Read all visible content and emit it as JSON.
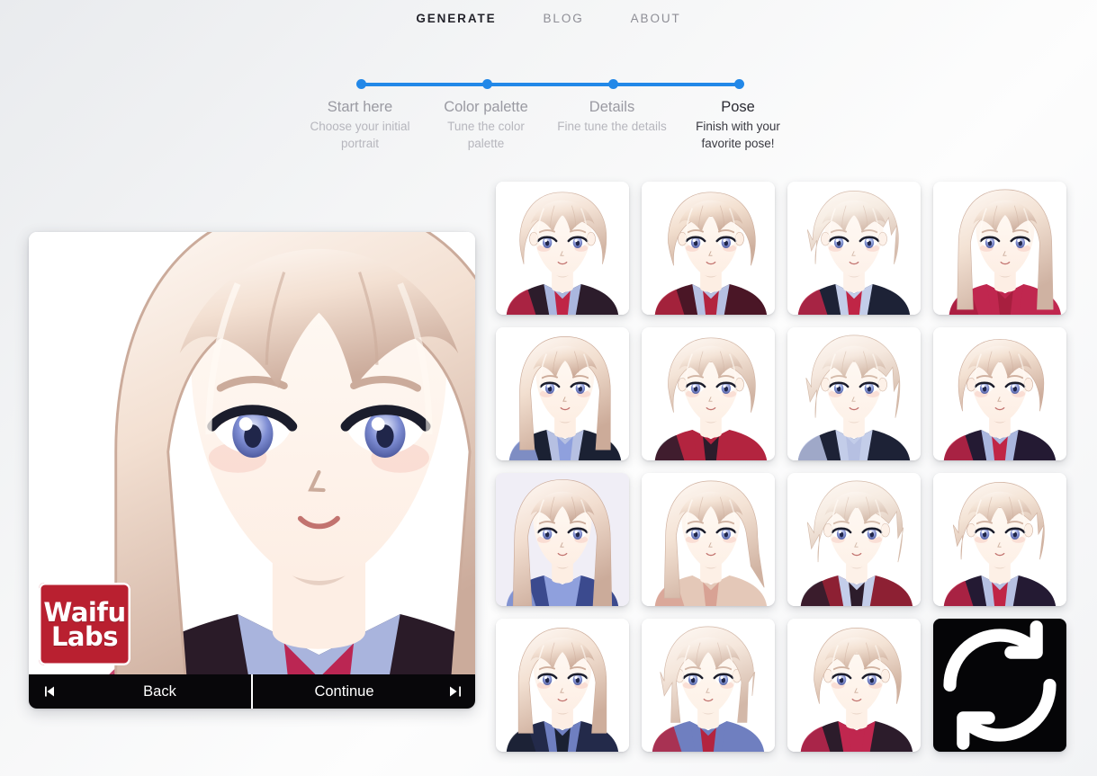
{
  "nav": {
    "items": [
      {
        "label": "GENERATE",
        "active": true
      },
      {
        "label": "BLOG",
        "active": false
      },
      {
        "label": "ABOUT",
        "active": false
      }
    ]
  },
  "stepper": {
    "accent_color": "#2288e8",
    "steps": [
      {
        "title": "Start here",
        "desc": "Choose your initial portrait",
        "active": false
      },
      {
        "title": "Color palette",
        "desc": "Tune the color palette",
        "active": false
      },
      {
        "title": "Details",
        "desc": "Fine tune the details",
        "active": false
      },
      {
        "title": "Pose",
        "desc": "Finish with your favorite pose!",
        "active": true
      }
    ]
  },
  "portrait": {
    "logo": {
      "line1": "Waifu",
      "line2": "Labs",
      "color": "#b92030"
    },
    "controls": {
      "back_label": "Back",
      "continue_label": "Continue",
      "back_icon": "skip-previous-icon",
      "continue_icon": "skip-next-icon"
    },
    "selected": {
      "hair_color": "#f3e0d2",
      "hair_shadow": "#cbab9b",
      "skin": "#fdeee4",
      "eye_color": "#7f8ed4",
      "collar": "#a9b4dd",
      "jacket": "#2a1b28",
      "accent": "#bb2653",
      "pose": "front-bust",
      "hair_style": "bob-long-bangs"
    }
  },
  "grid": {
    "columns": 4,
    "rows": 4,
    "reroll": {
      "icon": "refresh-icon",
      "label": ""
    },
    "tiles": [
      {
        "id": 1,
        "hair": "#f4e3d6",
        "shadow": "#d2b5a4",
        "skin": "#fdf0e7",
        "eye": "#8b98d8",
        "jacket": "#2c1c2b",
        "accent": "#c02546",
        "collar": "#aab6de",
        "pose": "front",
        "hair_style": "short-side-part",
        "bg": "#ffffff"
      },
      {
        "id": 2,
        "hair": "#f3e0d0",
        "shadow": "#cdae9c",
        "skin": "#fdeee3",
        "eye": "#8b98d8",
        "jacket": "#4a1626",
        "accent": "#b3243f",
        "collar": "#b6c0e2",
        "pose": "three-quarter",
        "hair_style": "swept-back",
        "bg": "#ffffff"
      },
      {
        "id": 3,
        "hair": "#f6ece2",
        "shadow": "#d6bdae",
        "skin": "#fdf1e9",
        "eye": "#8fa0dd",
        "jacket": "#1d2236",
        "accent": "#c02546",
        "collar": "#c3cde9",
        "pose": "front",
        "hair_style": "spiky",
        "bg": "#ffffff"
      },
      {
        "id": 4,
        "hair": "#f3e2d4",
        "shadow": "#cfb2a2",
        "skin": "#fdeee4",
        "eye": "#8b98d8",
        "jacket": "#c0274f",
        "accent": "#a81f3f",
        "collar": "#c0274f",
        "pose": "side-look",
        "hair_style": "long-straight",
        "bg": "#ffffff"
      },
      {
        "id": 5,
        "hair": "#f2dfd0",
        "shadow": "#ccab99",
        "skin": "#fdeee3",
        "eye": "#8b98d8",
        "jacket": "#1b2133",
        "accent": "#8fa0dd",
        "collar": "#b6c0e2",
        "pose": "three-quarter",
        "hair_style": "long-bangs",
        "bg": "#ffffff"
      },
      {
        "id": 6,
        "hair": "#f4e4d7",
        "shadow": "#d1b4a3",
        "skin": "#fdf0e6",
        "eye": "#8b98d8",
        "jacket": "#b3243f",
        "accent": "#2c1c2b",
        "collar": "#b3243f",
        "pose": "three-quarter",
        "hair_style": "short-fluffy",
        "bg": "#ffffff"
      },
      {
        "id": 7,
        "hair": "#f5e8de",
        "shadow": "#d4baa9",
        "skin": "#fdf1e8",
        "eye": "#8fa0dd",
        "jacket": "#1d2236",
        "accent": "#b6c0e2",
        "collar": "#c3cde9",
        "pose": "front",
        "hair_style": "messy-medium",
        "bg": "#ffffff"
      },
      {
        "id": 8,
        "hair": "#f3e1d2",
        "shadow": "#ceae9d",
        "skin": "#fdeee4",
        "eye": "#8b98d8",
        "jacket": "#241a33",
        "accent": "#c02546",
        "collar": "#aab6de",
        "pose": "front",
        "hair_style": "short-tidy",
        "bg": "#ffffff"
      },
      {
        "id": 9,
        "hair": "#f2ded0",
        "shadow": "#cbab9a",
        "skin": "#fdeee3",
        "eye": "#8b98d8",
        "jacket": "#3b4a8e",
        "accent": "#8fa0dd",
        "collar": "#8fa0dd",
        "pose": "front",
        "hair_style": "very-long",
        "bg": "#f0eef6"
      },
      {
        "id": 10,
        "hair": "#f4e3d5",
        "shadow": "#d0b2a1",
        "skin": "#fdf0e6",
        "eye": "#8fa0dd",
        "jacket": "#e4c8b8",
        "accent": "#d8a294",
        "collar": "#e4c8b8",
        "pose": "three-quarter",
        "hair_style": "long-ponytail",
        "bg": "#ffffff"
      },
      {
        "id": 11,
        "hair": "#f6ebe1",
        "shadow": "#d5bcac",
        "skin": "#fdf1e8",
        "eye": "#8b98d8",
        "jacket": "#8d2033",
        "accent": "#2c1c2b",
        "collar": "#c3cde9",
        "pose": "three-quarter",
        "hair_style": "spiky-fluffy",
        "bg": "#ffffff"
      },
      {
        "id": 12,
        "hair": "#f4e4d6",
        "shadow": "#d1b3a2",
        "skin": "#fdf0e6",
        "eye": "#8b98d8",
        "jacket": "#241a33",
        "accent": "#c02546",
        "collar": "#b6c0e2",
        "pose": "front",
        "hair_style": "messy-short",
        "bg": "#ffffff"
      },
      {
        "id": 13,
        "hair": "#f3e1d3",
        "shadow": "#ceae9c",
        "skin": "#fdeee4",
        "eye": "#8b98d8",
        "jacket": "#232a4a",
        "accent": "#1b2133",
        "collar": "#6f7fc0",
        "pose": "front",
        "hair_style": "medium-straight",
        "bg": "#ffffff"
      },
      {
        "id": 14,
        "hair": "#f5e7dc",
        "shadow": "#d3b8a8",
        "skin": "#fdf1e7",
        "eye": "#8fa0dd",
        "jacket": "#6f7fc0",
        "accent": "#b3243f",
        "collar": "#6f7fc0",
        "pose": "front",
        "hair_style": "fluffy-medium",
        "bg": "#ffffff"
      },
      {
        "id": 15,
        "hair": "#f4e3d5",
        "shadow": "#d0b2a0",
        "skin": "#fdf0e6",
        "eye": "#8b98d8",
        "jacket": "#2c1c2b",
        "accent": "#c0274f",
        "collar": "#c0274f",
        "pose": "three-quarter",
        "hair_style": "side-swept",
        "bg": "#ffffff"
      }
    ]
  }
}
